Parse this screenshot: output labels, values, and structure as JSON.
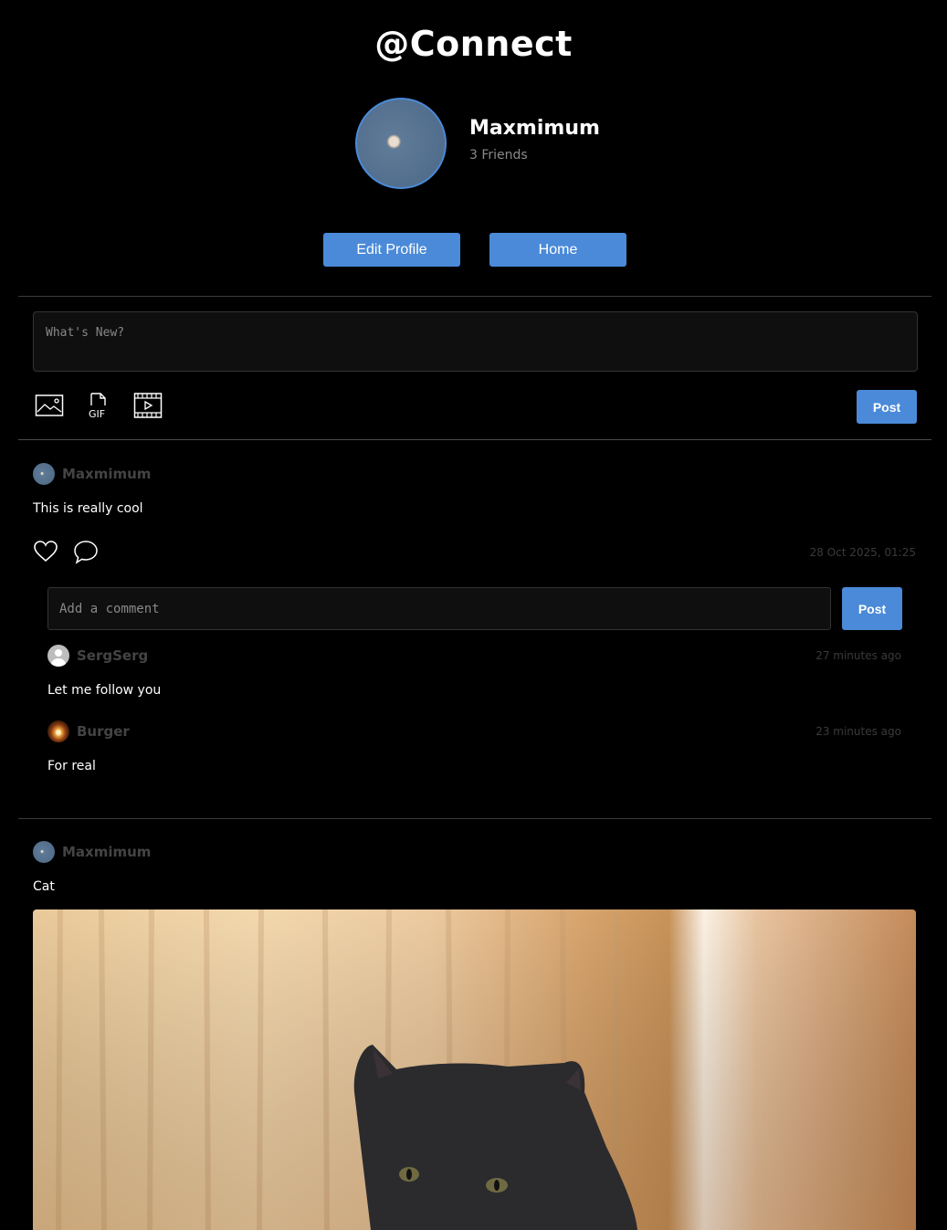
{
  "app": {
    "title": "@Connect"
  },
  "profile": {
    "name": "Maxmimum",
    "friends": "3 Friends"
  },
  "nav": {
    "edit_profile": "Edit Profile",
    "home": "Home"
  },
  "composer": {
    "placeholder": "What's New?",
    "post_label": "Post"
  },
  "media_icons": [
    "image-icon",
    "gif-icon",
    "video-icon"
  ],
  "posts": [
    {
      "author": "Maxmimum",
      "text": "This is really cool",
      "timestamp": "28 Oct 2025, 01:25",
      "comment_placeholder": "Add a comment",
      "comment_post_label": "Post",
      "comments": [
        {
          "author": "SergSerg",
          "time": "27 minutes ago",
          "text": "Let me follow you"
        },
        {
          "author": "Burger",
          "time": "23 minutes ago",
          "text": "For real"
        }
      ]
    },
    {
      "author": "Maxmimum",
      "text": "Cat"
    }
  ],
  "colors": {
    "accent": "#4a8ad8",
    "background": "#000000",
    "muted": "#444444"
  }
}
